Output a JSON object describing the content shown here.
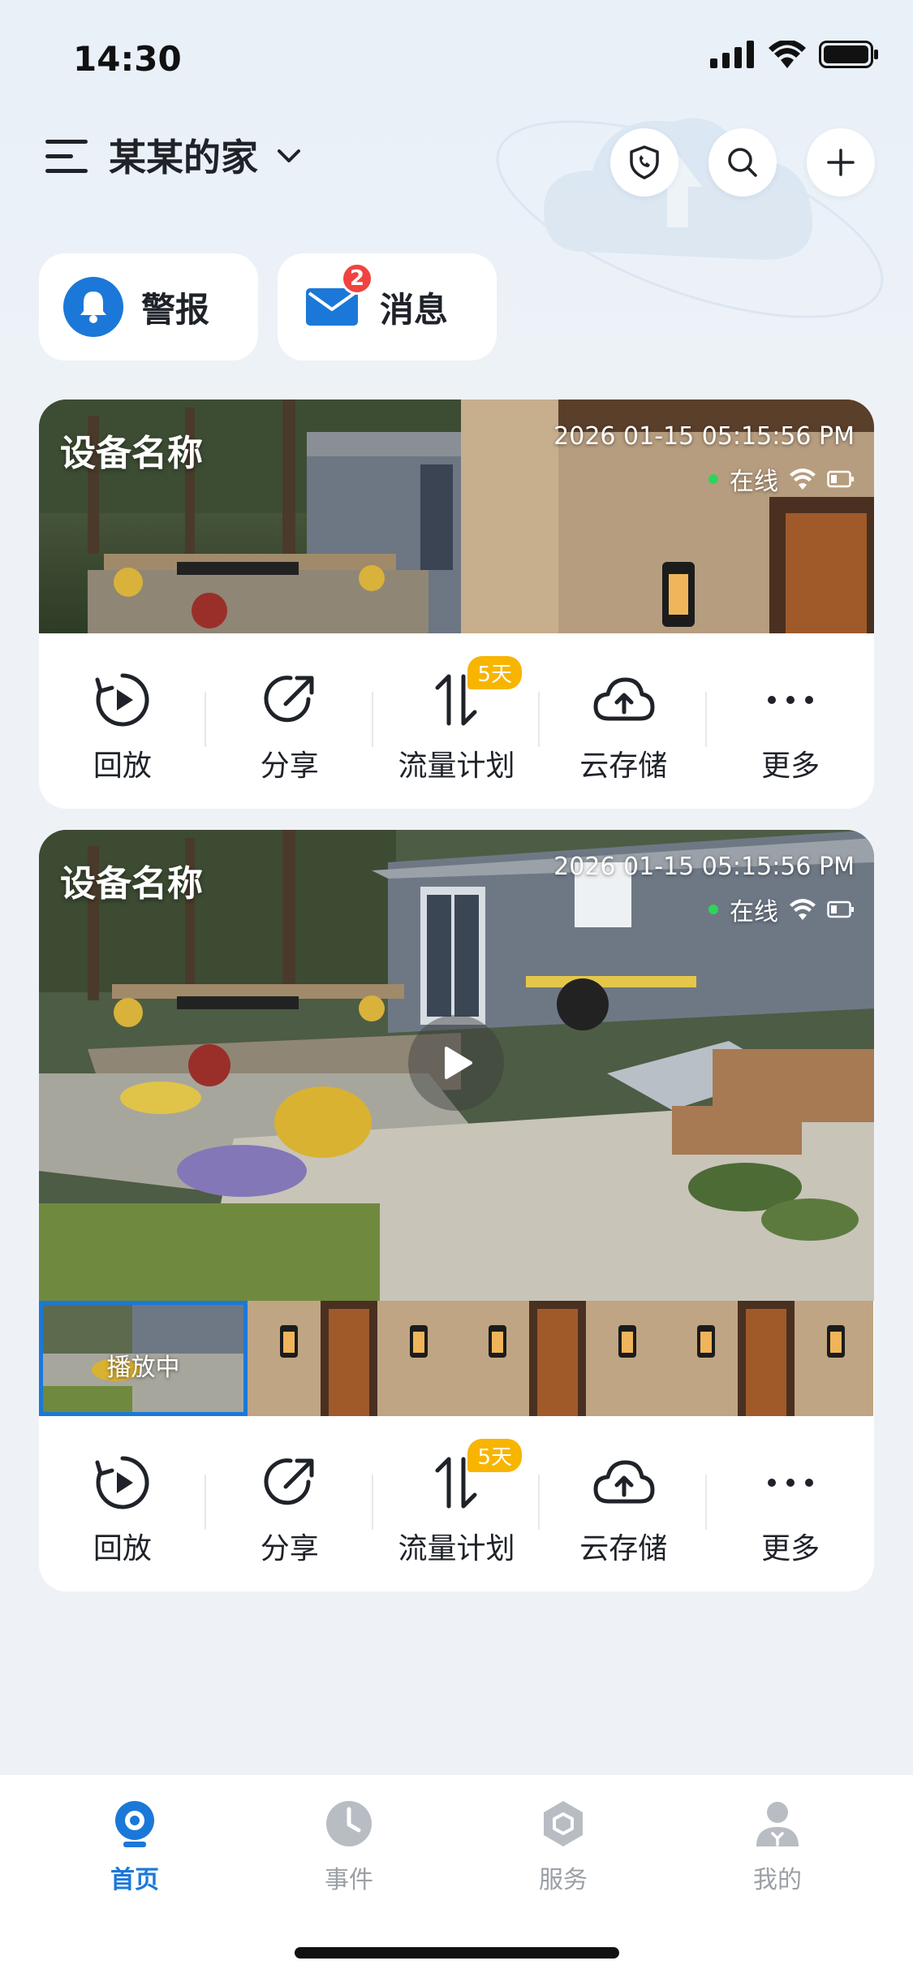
{
  "status_bar": {
    "time": "14:30"
  },
  "header": {
    "home_name": "某某的家"
  },
  "quick_tiles": {
    "alert_label": "警报",
    "message_label": "消息",
    "message_count": "2"
  },
  "devices": [
    {
      "name": "设备名称",
      "timestamp": "2026 01-15 05:15:56  PM",
      "status": "在线",
      "actions": [
        "回放",
        "分享",
        "流量计划",
        "云存储",
        "更多"
      ],
      "plan_badge": "5天"
    },
    {
      "name": "设备名称",
      "timestamp": "2026 01-15 05:15:56  PM",
      "status": "在线",
      "playing_label": "播放中",
      "actions": [
        "回放",
        "分享",
        "流量计划",
        "云存储",
        "更多"
      ],
      "plan_badge": "5天"
    }
  ],
  "tabbar": {
    "tabs": [
      "首页",
      "事件",
      "服务",
      "我的"
    ],
    "active": "首页"
  },
  "colors": {
    "accent": "#1b78d8",
    "badge": "#f0433f",
    "plan_tag": "#f7b500",
    "online": "#2fd35a"
  }
}
